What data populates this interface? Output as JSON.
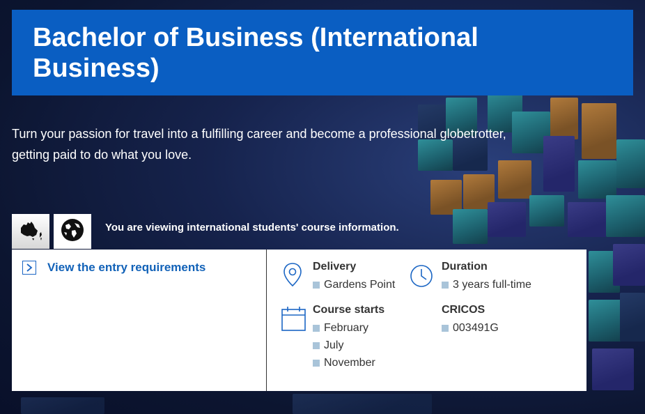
{
  "course": {
    "title": "Bachelor of Business (International Business)",
    "intro": "Turn your passion for travel into a fulfilling career and become a professional globetrotter, getting paid to do what you love."
  },
  "student_type": {
    "options": [
      {
        "id": "australian",
        "icon": "australia-map-icon"
      },
      {
        "id": "international",
        "icon": "globe-icon"
      }
    ],
    "notice": "You are viewing international students' course information."
  },
  "entry": {
    "link_label": "View the entry requirements",
    "icon": "chevron-right-icon"
  },
  "details": {
    "delivery": {
      "heading": "Delivery",
      "values": [
        "Gardens Point"
      ],
      "icon": "location-pin-icon"
    },
    "duration": {
      "heading": "Duration",
      "values": [
        "3 years full-time"
      ],
      "icon": "clock-icon"
    },
    "course_starts": {
      "heading": "Course starts",
      "values": [
        "February",
        "July",
        "November"
      ],
      "icon": "calendar-icon"
    },
    "cricos": {
      "heading": "CRICOS",
      "values": [
        "003491G"
      ]
    }
  },
  "colors": {
    "title_bg": "#0a5ec2",
    "link": "#1262b8",
    "bullet": "#a9c4d9"
  }
}
